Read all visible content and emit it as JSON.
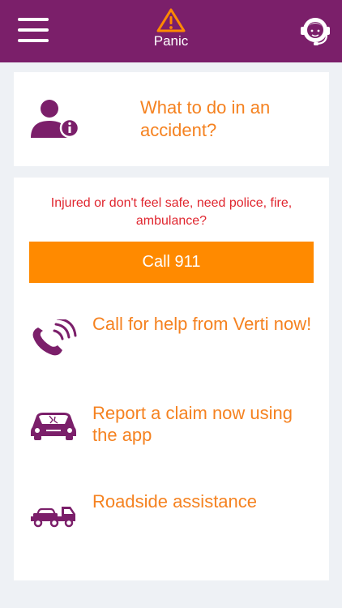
{
  "header": {
    "panic_label": "Panic",
    "background_color": "#7b1f6a",
    "icons": [
      "menu-icon",
      "warning-icon",
      "headset-icon"
    ]
  },
  "accident": {
    "text": "What to do in an accident?",
    "icon": "user-info-icon"
  },
  "emergency": {
    "injured_text": "Injured or don't feel safe, need police, fire, ambulance?",
    "call_label": "Call 911",
    "button_color": "#ff8a00"
  },
  "options": [
    {
      "text": "Call for help from Verti now!",
      "icon": "phone-call-icon"
    },
    {
      "text": "Report a claim now using the app",
      "icon": "damaged-car-icon"
    },
    {
      "text": "Roadside assistance",
      "icon": "tow-truck-icon"
    }
  ],
  "colors": {
    "accent": "#f58220",
    "brand": "#7b1f6a",
    "alert_text": "#e0262f"
  }
}
